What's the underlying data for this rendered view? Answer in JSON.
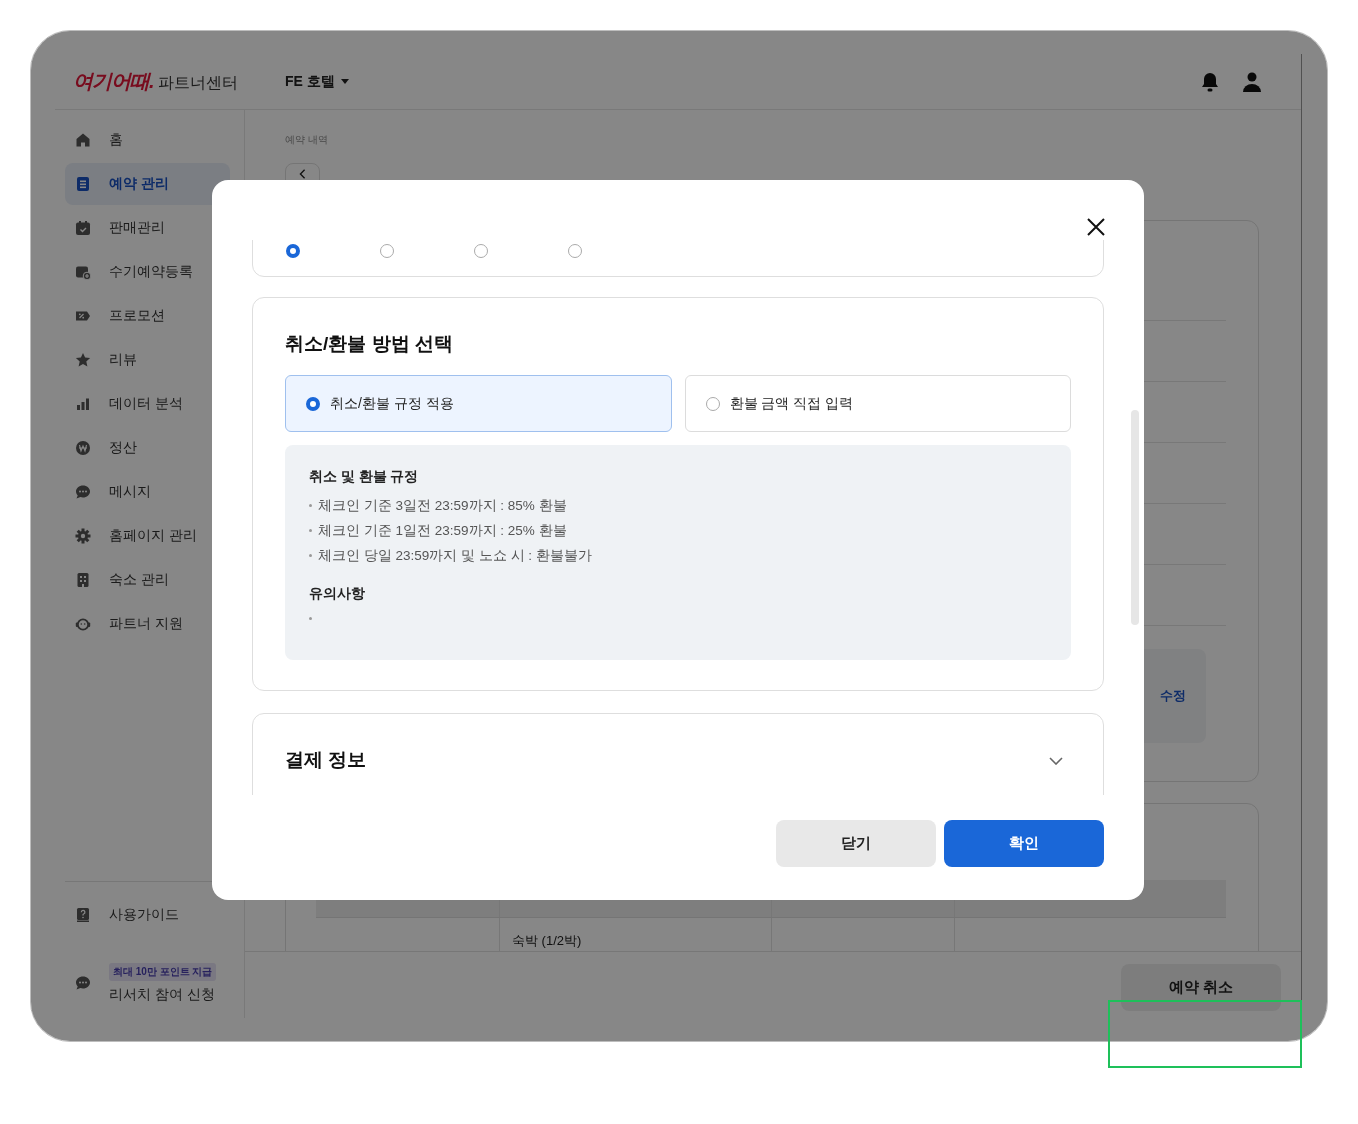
{
  "header": {
    "logo": "여기어때.",
    "logo_suffix": "파트너센터",
    "property_selector": "FE 호텔"
  },
  "sidebar": {
    "items": [
      {
        "label": "홈",
        "selected": false
      },
      {
        "label": "예약 관리",
        "selected": true
      },
      {
        "label": "판매관리",
        "selected": false
      },
      {
        "label": "수기예약등록",
        "selected": false
      },
      {
        "label": "프로모션",
        "selected": false
      },
      {
        "label": "리뷰",
        "selected": false
      },
      {
        "label": "데이터 분석",
        "selected": false
      },
      {
        "label": "정산",
        "selected": false
      },
      {
        "label": "메시지",
        "selected": false
      },
      {
        "label": "홈페이지 관리",
        "selected": false
      },
      {
        "label": "숙소 관리",
        "selected": false
      },
      {
        "label": "파트너 지원",
        "selected": false
      }
    ],
    "footer_items": [
      {
        "label": "사용가이드"
      },
      {
        "label": "리서치 참여 신청",
        "badge": "최대 10만 포인트 지급"
      }
    ]
  },
  "page": {
    "breadcrumb": "예약 내역",
    "edit_button": "수정",
    "table_cell": "숙박 (1/2박)",
    "cancel_button": "예약 취소"
  },
  "modal": {
    "top_radios": [
      {
        "selected": true
      },
      {
        "selected": false
      },
      {
        "selected": false
      },
      {
        "selected": false
      }
    ],
    "method_section": {
      "title": "취소/환불 방법 선택",
      "options": [
        {
          "label": "취소/환불 규정 적용",
          "selected": true
        },
        {
          "label": "환불 금액 직접 입력",
          "selected": false
        }
      ],
      "policy": {
        "title": "취소 및 환불 규정",
        "items": [
          "체크인 기준 3일전 23:59까지 : 85% 환불",
          "체크인 기준 1일전 23:59까지 : 25% 환불",
          "체크인 당일 23:59까지 및 노쇼 시 : 환불불가"
        ],
        "notes_title": "유의사항"
      }
    },
    "payment_section": {
      "title": "결제 정보",
      "expanded": false
    },
    "buttons": [
      {
        "label": "닫기",
        "kind": "secondary"
      },
      {
        "label": "확인",
        "kind": "primary"
      }
    ]
  }
}
